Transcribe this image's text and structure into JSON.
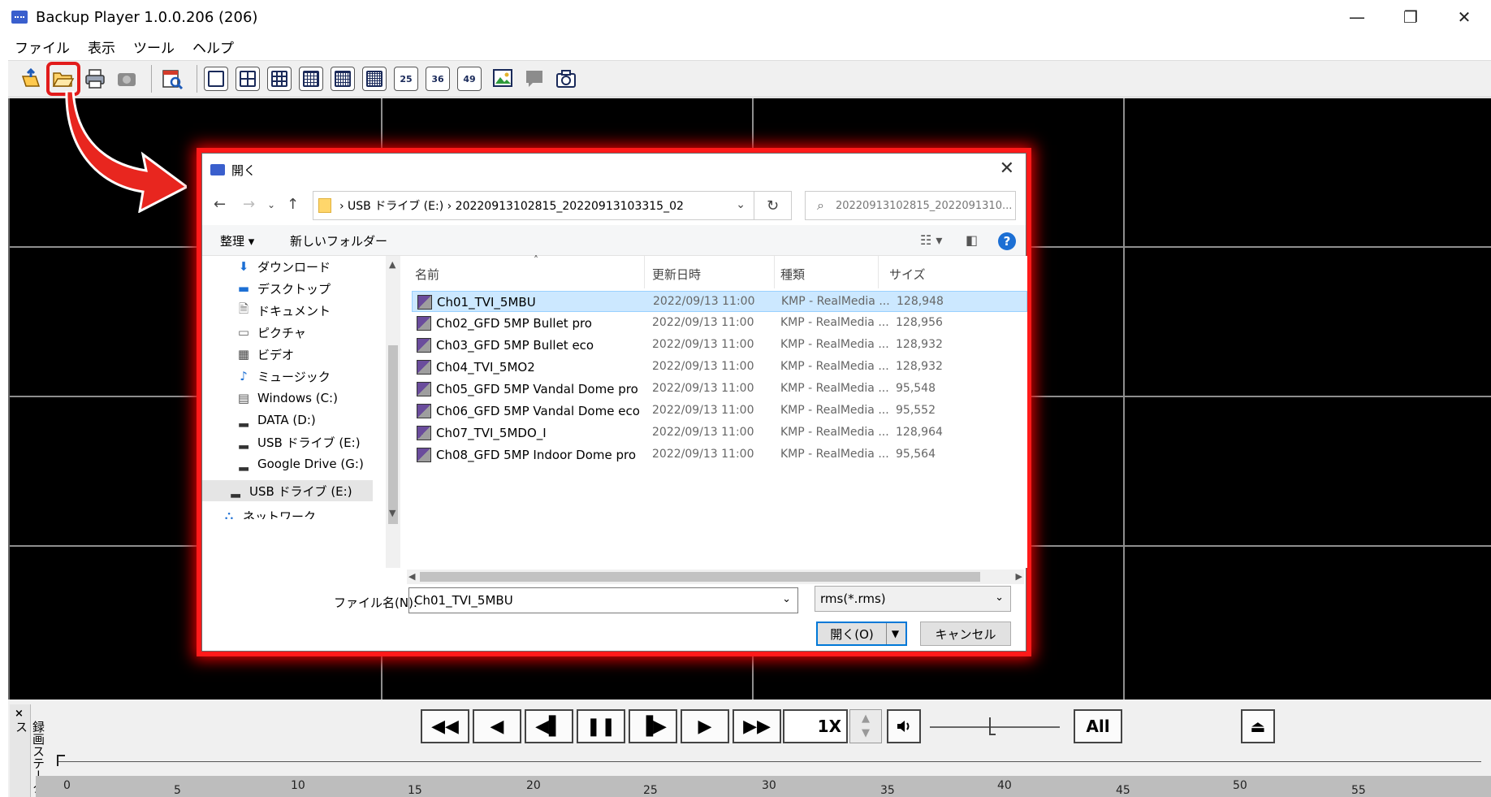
{
  "window": {
    "title": "Backup Player 1.0.0.206 (206)",
    "minimize": "—",
    "restore": "❐",
    "close": "✕"
  },
  "menu": [
    "ファイル",
    "表示",
    "ツール",
    "ヘルプ"
  ],
  "toolbar": {
    "grid_labels": [
      "25",
      "36",
      "49"
    ]
  },
  "dialog": {
    "title": "開く",
    "close": "✕",
    "path": "›  USB ドライブ (E:)  ›  20220913102815_20220913103315_02",
    "search_placeholder": "20220913102815_2022091310...",
    "organize": "整理 ▾",
    "new_folder": "新しいフォルダー",
    "nav_items": [
      {
        "icon": "download-icon",
        "glyph": "⬇",
        "label": "ダウンロード"
      },
      {
        "icon": "desktop-icon",
        "glyph": "▬",
        "label": "デスクトップ"
      },
      {
        "icon": "documents-icon",
        "glyph": "🗎",
        "label": "ドキュメント"
      },
      {
        "icon": "pictures-icon",
        "glyph": "▭",
        "label": "ピクチャ"
      },
      {
        "icon": "videos-icon",
        "glyph": "▦",
        "label": "ビデオ"
      },
      {
        "icon": "music-icon",
        "glyph": "♪",
        "label": "ミュージック"
      },
      {
        "icon": "windows-drive-icon",
        "glyph": "▤",
        "label": "Windows (C:)"
      },
      {
        "icon": "drive-icon",
        "glyph": "▂",
        "label": "DATA (D:)"
      },
      {
        "icon": "usb-drive-icon",
        "glyph": "▂",
        "label": "USB ドライブ (E:)"
      },
      {
        "icon": "drive-icon",
        "glyph": "▂",
        "label": "Google Drive (G:)"
      }
    ],
    "nav_selected": {
      "icon": "usb-drive-icon",
      "glyph": "▂",
      "label": "USB ドライブ (E:)"
    },
    "nav_partial": {
      "icon": "network-icon",
      "glyph": "⛬",
      "label": "ネットワーク"
    },
    "columns": {
      "name": "名前",
      "date": "更新日時",
      "type": "種類",
      "size": "サイズ"
    },
    "files": [
      {
        "name": "Ch01_TVI_5MBU",
        "date": "2022/09/13 11:00",
        "type": "KMP - RealMedia ...",
        "size": "128,948"
      },
      {
        "name": "Ch02_GFD 5MP Bullet pro",
        "date": "2022/09/13 11:00",
        "type": "KMP - RealMedia ...",
        "size": "128,956"
      },
      {
        "name": "Ch03_GFD 5MP Bullet eco",
        "date": "2022/09/13 11:00",
        "type": "KMP - RealMedia ...",
        "size": "128,932"
      },
      {
        "name": "Ch04_TVI_5MO2",
        "date": "2022/09/13 11:00",
        "type": "KMP - RealMedia ...",
        "size": "128,932"
      },
      {
        "name": "Ch05_GFD 5MP Vandal Dome pro",
        "date": "2022/09/13 11:00",
        "type": "KMP - RealMedia ...",
        "size": "95,548"
      },
      {
        "name": "Ch06_GFD 5MP Vandal Dome eco",
        "date": "2022/09/13 11:00",
        "type": "KMP - RealMedia ...",
        "size": "95,552"
      },
      {
        "name": "Ch07_TVI_5MDO_I",
        "date": "2022/09/13 11:00",
        "type": "KMP - RealMedia ...",
        "size": "128,964"
      },
      {
        "name": "Ch08_GFD 5MP Indoor Dome pro",
        "date": "2022/09/13 11:00",
        "type": "KMP - RealMedia ...",
        "size": "95,564"
      }
    ],
    "filename_label": "ファイル名(N):",
    "filename_value": "Ch01_TVI_5MBU",
    "filetype": "rms(*.rms)",
    "open_label": "開く(O)",
    "cancel_label": "キャンセル"
  },
  "player": {
    "side_label": "録画ステータス",
    "speed": "1X",
    "all_label": "All",
    "ruler_ticks": [
      "0",
      "5",
      "10",
      "15",
      "20",
      "25",
      "30",
      "35",
      "40",
      "45",
      "50",
      "55"
    ]
  },
  "colors": {
    "highlight": "#e21b1b",
    "selected_row": "#cce8ff",
    "accent": "#0078d7"
  }
}
